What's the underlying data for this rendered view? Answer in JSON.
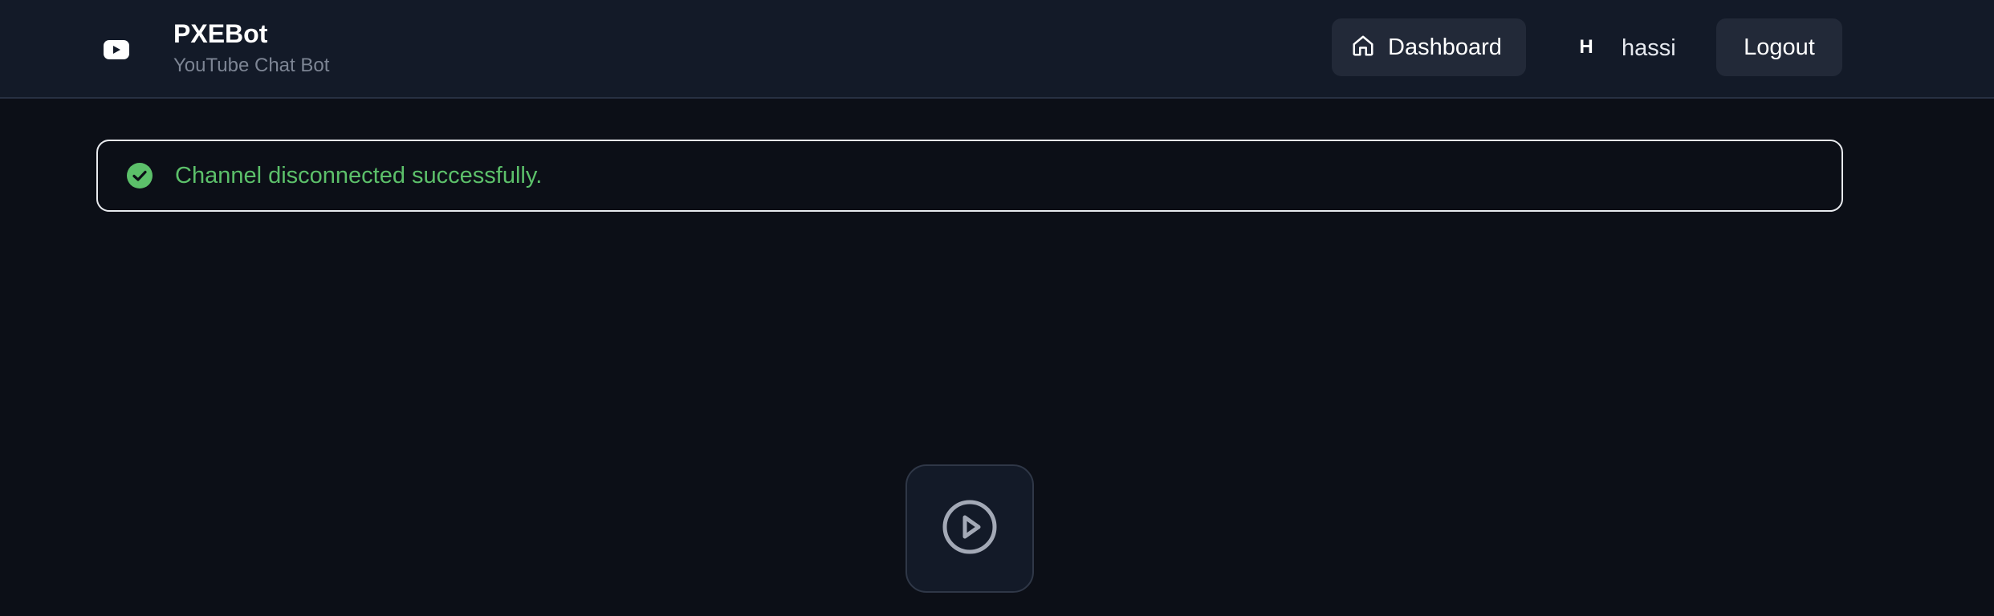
{
  "header": {
    "brand_title": "PXEBot",
    "brand_subtitle": "YouTube Chat Bot",
    "logo_icon": "youtube-play-icon",
    "nav": {
      "dashboard_label": "Dashboard",
      "dashboard_icon": "home-icon"
    },
    "user": {
      "avatar_initial": "H",
      "name": "hassi"
    },
    "logout_label": "Logout"
  },
  "alert": {
    "icon": "check-circle-icon",
    "message": "Channel disconnected successfully.",
    "color": "#5cc06a"
  },
  "main": {
    "placeholder_icon": "play-circle-icon"
  },
  "colors": {
    "background": "#0c0f17",
    "header_bg": "#131a28",
    "button_bg": "#222938",
    "success": "#5cc06a"
  }
}
